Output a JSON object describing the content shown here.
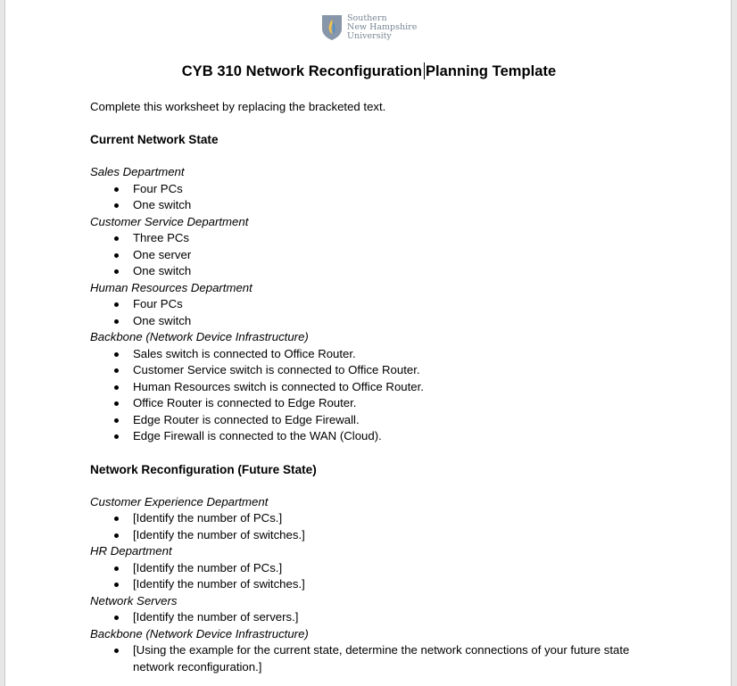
{
  "logo": {
    "name": "snhu-logo",
    "lines": [
      "Southern",
      "New Hampshire",
      "University"
    ],
    "colors": {
      "shield": "#8796a8",
      "flame_blue": "#3f8fd1",
      "flame_yellow": "#f2c14e",
      "text": "#7a8796"
    }
  },
  "document": {
    "title_part1": "CYB 310 Network Reconfiguration",
    "title_part2": "Planning Template",
    "intro": "Complete this worksheet by replacing the bracketed text.",
    "sections": [
      {
        "heading": "Current Network State",
        "groups": [
          {
            "subheading": "Sales Department",
            "items": [
              "Four PCs",
              "One switch"
            ]
          },
          {
            "subheading": "Customer Service Department",
            "items": [
              "Three PCs",
              "One server",
              "One switch"
            ]
          },
          {
            "subheading": "Human Resources Department",
            "items": [
              "Four PCs",
              "One switch"
            ]
          },
          {
            "subheading": "Backbone (Network Device Infrastructure)",
            "items": [
              "Sales switch is connected to Office Router.",
              "Customer Service switch is connected to Office Router.",
              "Human Resources switch is connected to Office Router.",
              "Office Router is connected to Edge Router.",
              "Edge Router is connected to Edge Firewall.",
              "Edge Firewall is connected to the WAN (Cloud)."
            ]
          }
        ]
      },
      {
        "heading": "Network Reconfiguration (Future State)",
        "groups": [
          {
            "subheading": "Customer Experience Department",
            "items": [
              "[Identify the number of PCs.]",
              "[Identify the number of switches.]"
            ]
          },
          {
            "subheading": "HR Department",
            "items": [
              "[Identify the number of PCs.]",
              "[Identify the number of switches.]"
            ]
          },
          {
            "subheading": "Network Servers",
            "items": [
              "[Identify the number of servers.]"
            ]
          },
          {
            "subheading": "Backbone (Network Device Infrastructure)",
            "items": [
              "[Using the example for the current state, determine the network connections of your future state network reconfiguration.]"
            ]
          }
        ]
      }
    ]
  }
}
